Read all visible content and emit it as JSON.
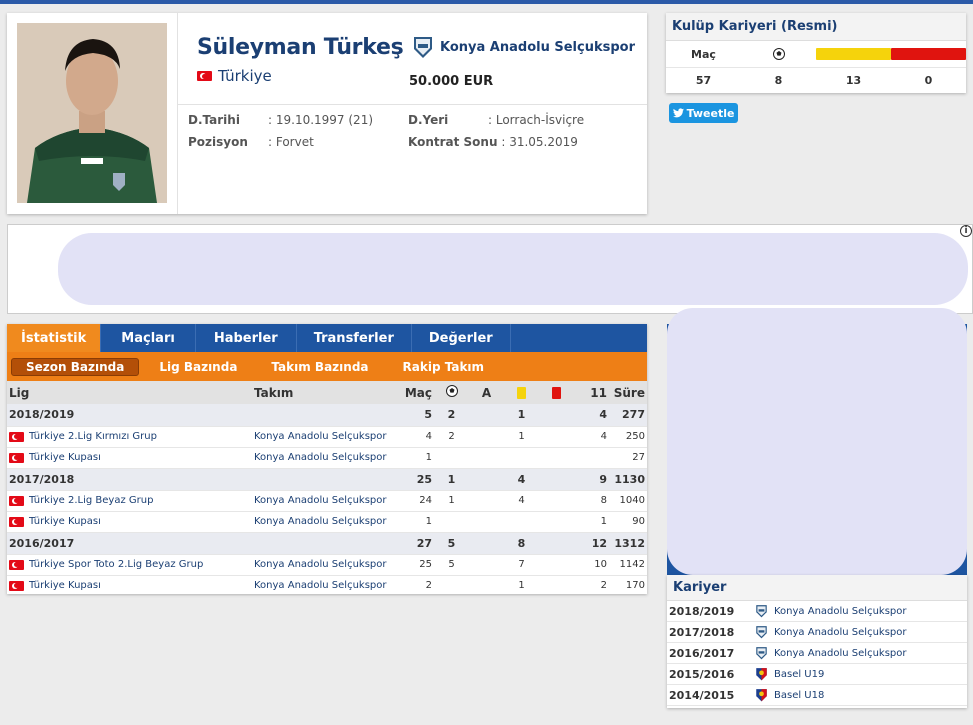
{
  "profile": {
    "name": "Süleyman Türkeş",
    "nationality": "Türkiye",
    "club": "Konya Anadolu Selçukspor",
    "value": "50.000 EUR",
    "birth_label": "D.Tarihi",
    "birth_value": ": 19.10.1997 (21)",
    "position_label": "Pozisyon",
    "position_value": ": Forvet",
    "birthplace_label": "D.Yeri",
    "birthplace_value": ": Lorrach-İsviçre",
    "contract_label": "Kontrat Sonu",
    "contract_value": ": 31.05.2019"
  },
  "club_career": {
    "title": "Kulüp Kariyeri (Resmi)",
    "headers": {
      "matches": "Maç"
    },
    "values": {
      "matches": "57",
      "goals": "8",
      "yellow": "13",
      "red": "0"
    }
  },
  "tweet_label": "Tweetle",
  "tabs": [
    "İstatistik",
    "Maçları",
    "Haberler",
    "Transferler",
    "Değerler"
  ],
  "subtabs": [
    "Sezon Bazında",
    "Lig Bazında",
    "Takım Bazında",
    "Rakip Takım"
  ],
  "table": {
    "headers": {
      "league": "Lig",
      "team": "Takım",
      "matches": "Maç",
      "assists": "A",
      "starting": "11",
      "time": "Süre"
    },
    "rows": [
      {
        "season": "2018/2019",
        "m": "5",
        "g": "2",
        "a": "",
        "y": "1",
        "r": "",
        "s": "4",
        "t": "277"
      },
      {
        "league": "Türkiye 2.Lig Kırmızı Grup",
        "team": "Konya Anadolu Selçukspor",
        "m": "4",
        "g": "2",
        "a": "",
        "y": "1",
        "r": "",
        "s": "4",
        "t": "250"
      },
      {
        "league": "Türkiye Kupası",
        "team": "Konya Anadolu Selçukspor",
        "m": "1",
        "g": "",
        "a": "",
        "y": "",
        "r": "",
        "s": "",
        "t": "27"
      },
      {
        "season": "2017/2018",
        "m": "25",
        "g": "1",
        "a": "",
        "y": "4",
        "r": "",
        "s": "9",
        "t": "1130"
      },
      {
        "league": "Türkiye 2.Lig Beyaz Grup",
        "team": "Konya Anadolu Selçukspor",
        "m": "24",
        "g": "1",
        "a": "",
        "y": "4",
        "r": "",
        "s": "8",
        "t": "1040"
      },
      {
        "league": "Türkiye Kupası",
        "team": "Konya Anadolu Selçukspor",
        "m": "1",
        "g": "",
        "a": "",
        "y": "",
        "r": "",
        "s": "1",
        "t": "90"
      },
      {
        "season": "2016/2017",
        "m": "27",
        "g": "5",
        "a": "",
        "y": "8",
        "r": "",
        "s": "12",
        "t": "1312"
      },
      {
        "league": "Türkiye Spor Toto 2.Lig Beyaz Grup",
        "team": "Konya Anadolu Selçukspor",
        "m": "25",
        "g": "5",
        "a": "",
        "y": "7",
        "r": "",
        "s": "10",
        "t": "1142"
      },
      {
        "league": "Türkiye Kupası",
        "team": "Konya Anadolu Selçukspor",
        "m": "2",
        "g": "",
        "a": "",
        "y": "1",
        "r": "",
        "s": "2",
        "t": "170"
      }
    ]
  },
  "career": {
    "title": "Kariyer",
    "rows": [
      {
        "year": "2018/2019",
        "club": "Konya Anadolu Selçukspor",
        "crest": "konya"
      },
      {
        "year": "2017/2018",
        "club": "Konya Anadolu Selçukspor",
        "crest": "konya"
      },
      {
        "year": "2016/2017",
        "club": "Konya Anadolu Selçukspor",
        "crest": "konya"
      },
      {
        "year": "2015/2016",
        "club": "Basel U19",
        "crest": "basel"
      },
      {
        "year": "2014/2015",
        "club": "Basel U18",
        "crest": "basel"
      }
    ]
  },
  "colors": {
    "accent_blue": "#1e55a1",
    "accent_orange": "#ee7f16",
    "link": "#1b3f73"
  }
}
